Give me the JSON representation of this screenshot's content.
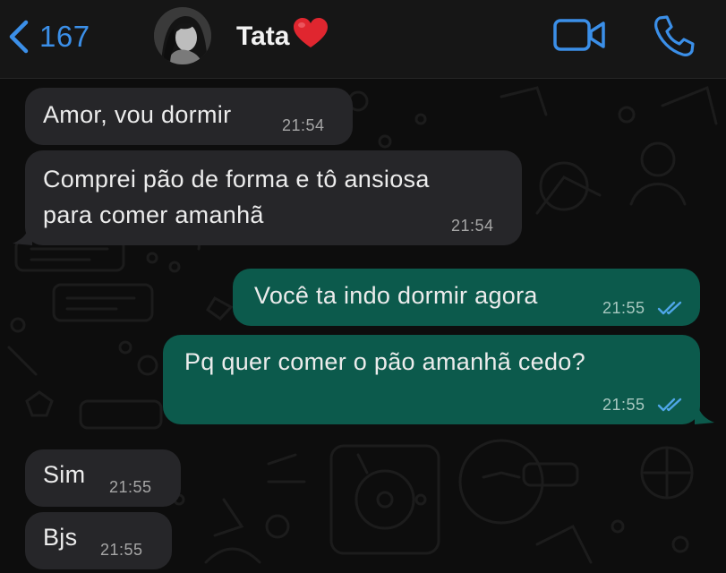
{
  "header": {
    "back_count": "167",
    "contact_name": "Tata",
    "icons": {
      "back": "chevron-left-icon",
      "status": "heart-icon",
      "video": "video-camera-icon",
      "call": "phone-icon"
    }
  },
  "messages": [
    {
      "direction": "received",
      "text": "Amor, vou dormir",
      "time": "21:54"
    },
    {
      "direction": "received",
      "text": "Comprei pão de forma e tô ansiosa\npara comer amanhã",
      "time": "21:54"
    },
    {
      "direction": "sent",
      "text": "Você ta indo dormir agora",
      "time": "21:55",
      "status": "read"
    },
    {
      "direction": "sent",
      "text": "Pq quer comer o pão amanhã cedo?",
      "time": "21:55",
      "status": "read"
    },
    {
      "direction": "received",
      "text": "Sim",
      "time": "21:55"
    },
    {
      "direction": "received",
      "text": "Bjs",
      "time": "21:55"
    }
  ],
  "colors": {
    "accent": "#3b8fe8",
    "header_bg": "#161616",
    "chat_bg": "#0d0d0d",
    "received_bubble": "#262629",
    "sent_bubble": "#0c5a4c",
    "read_ticks": "#4fa6e8",
    "heart": "#e0262f"
  }
}
